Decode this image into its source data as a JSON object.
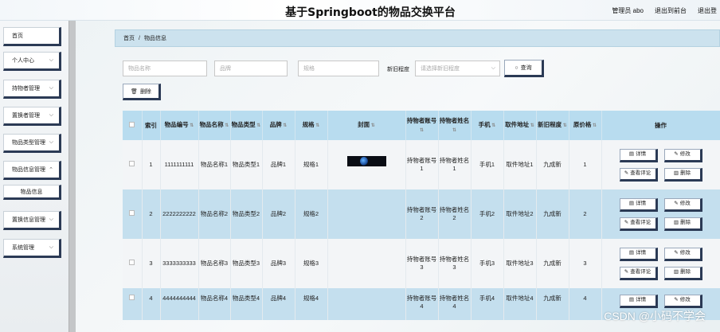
{
  "header": {
    "title": "基于Springboot的物品交换平台",
    "admin_label": "管理员 abo",
    "front_label": "退出到前台",
    "logout_label": "退出登"
  },
  "sidebar": {
    "items": [
      {
        "label": "首页"
      },
      {
        "label": "个人中心"
      },
      {
        "label": "持物者管理"
      },
      {
        "label": "置换者管理"
      },
      {
        "label": "物品类型管理"
      },
      {
        "label": "物品信息管理"
      },
      {
        "label": "物品信息"
      },
      {
        "label": "置换信息管理"
      },
      {
        "label": "系统管理"
      }
    ]
  },
  "breadcrumb": {
    "home": "首页",
    "sep": "/",
    "current": "物品信息"
  },
  "search": {
    "name_placeholder": "物品名称",
    "brand_placeholder": "品牌",
    "spec_placeholder": "规格",
    "condition_label": "新旧程度",
    "condition_placeholder": "请选择新旧程度",
    "search_label": "查询"
  },
  "toolbar": {
    "delete_label": "删除"
  },
  "table": {
    "headers": [
      "索引",
      "物品编号",
      "物品名称",
      "物品类型",
      "品牌",
      "规格",
      "封面",
      "持物者账号",
      "持物者姓名",
      "手机",
      "取件地址",
      "新旧程度",
      "原价格",
      "操作"
    ],
    "rows": [
      {
        "idx": "1",
        "code": "1111111111",
        "name": "物品名称1",
        "type": "物品类型1",
        "brand": "品牌1",
        "spec": "规格1",
        "owner_acct": "持物者账号1",
        "owner_name": "持物者姓名1",
        "phone": "手机1",
        "addr": "取件地址1",
        "cond": "九成新",
        "price": "1"
      },
      {
        "idx": "2",
        "code": "2222222222",
        "name": "物品名称2",
        "type": "物品类型2",
        "brand": "品牌2",
        "spec": "规格2",
        "owner_acct": "持物者账号2",
        "owner_name": "持物者姓名2",
        "phone": "手机2",
        "addr": "取件地址2",
        "cond": "九成新",
        "price": "2"
      },
      {
        "idx": "3",
        "code": "3333333333",
        "name": "物品名称3",
        "type": "物品类型3",
        "brand": "品牌3",
        "spec": "规格3",
        "owner_acct": "持物者账号3",
        "owner_name": "持物者姓名3",
        "phone": "手机3",
        "addr": "取件地址3",
        "cond": "九成新",
        "price": "3"
      },
      {
        "idx": "4",
        "code": "4444444444",
        "name": "物品名称4",
        "type": "物品类型4",
        "brand": "品牌4",
        "spec": "规格4",
        "owner_acct": "持物者账号4",
        "owner_name": "持物者姓名4",
        "phone": "手机4",
        "addr": "取件地址4",
        "cond": "九成新",
        "price": "4"
      }
    ],
    "actions": {
      "detail": "详情",
      "edit": "修改",
      "review": "查看评论",
      "delete": "删除"
    }
  },
  "watermark": "CSDN @小码不学会"
}
